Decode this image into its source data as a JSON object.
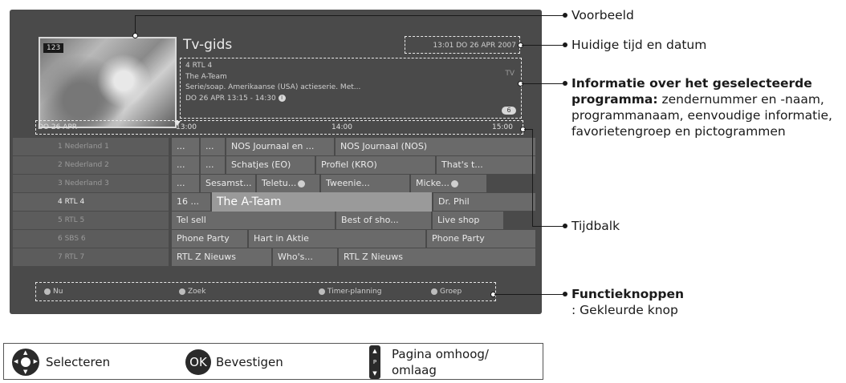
{
  "tv": {
    "channel_badge": "123",
    "title": "Tv-gids",
    "clock": "13:01  DO 26 APR 2007",
    "info": {
      "channel": "4  RTL 4",
      "program": "The A-Team",
      "description": "Serie/soap. Amerikaanse (USA) actieserie. Met...",
      "datetime": "DO 26 APR 13:15 - 14:30",
      "tag": "TV",
      "rating_icon": "6"
    },
    "timebar": {
      "date": "DO 26 APR",
      "times": [
        "13:00",
        "14:00",
        "15:00"
      ]
    },
    "channels": [
      {
        "name": "1  Nederland 1",
        "programs": [
          "...",
          "...",
          "NOS Journaal en ...",
          "NOS Journaal (NOS)"
        ]
      },
      {
        "name": "2  Nederland 2",
        "programs": [
          "...",
          "...",
          "Schatjes (EO)",
          "Profiel (KRO)",
          "That's t..."
        ]
      },
      {
        "name": "3  Nederland 3",
        "programs": [
          "...",
          "Sesamst...",
          "Teletu...",
          "Tweenie...",
          "Micke..."
        ]
      },
      {
        "name": "4  RTL 4",
        "programs": [
          "16 ...",
          "The A-Team",
          "Dr. Phil"
        ]
      },
      {
        "name": "5  RTL 5",
        "programs": [
          "Tel sell",
          "Best of sho...",
          "Live shop"
        ]
      },
      {
        "name": "6  SBS 6",
        "programs": [
          "Phone Party",
          "Hart in Aktie",
          "Phone Party"
        ]
      },
      {
        "name": "7  RTL 7",
        "programs": [
          "RTL Z Nieuws",
          "Who's...",
          "RTL Z Nieuws"
        ]
      }
    ],
    "function_keys": [
      "Nu",
      "Zoek",
      "Timer-planning",
      "Groep"
    ]
  },
  "callouts": {
    "preview": "Voorbeeld",
    "time_date": "Huidige tijd en datum",
    "info_bold": "Informatie over het geselecteerde programma:",
    "info_rest": " zendernummer en -naam, programmanaam, eenvoudige informatie,",
    "info_last": "favorietengroep en pictogrammen",
    "timebar": "Tijdbalk",
    "func_bold": "Functieknoppen",
    "func_rest": ": Gekleurde knop"
  },
  "legend": {
    "select": "Selecteren",
    "ok_glyph": "OK",
    "confirm": "Bevestigen",
    "page_line1": "Pagina omhoog/",
    "page_line2": "omlaag"
  },
  "icons": [
    "dpad-icon",
    "ok-button-icon",
    "page-button-icon",
    "clock-icon",
    "info-icon"
  ]
}
